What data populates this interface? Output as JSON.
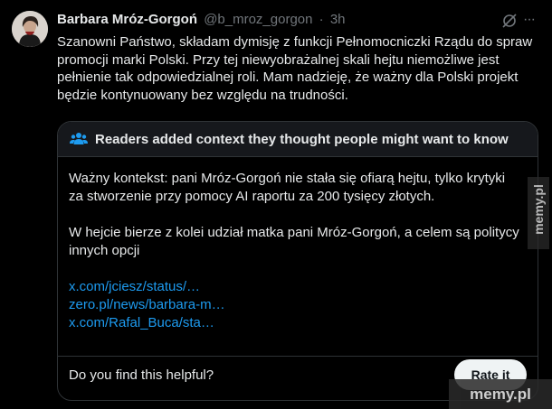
{
  "post": {
    "author_name": "Barbara Mróz-Gorgoń",
    "handle": "@b_mroz_gorgon",
    "separator": "·",
    "time": "3h",
    "more_glyph": "···",
    "text": "Szanowni Państwo, składam dymisję z funkcji Pełnomocniczki Rządu do spraw promocji marki Polski. Przy tej niewyobrażalnej skali hejtu niemożliwe jest pełnienie tak odpowiedzialnej roli. Mam nadzieję, że ważny dla Polski projekt będzie kontynuowany bez względu na trudności."
  },
  "community_note": {
    "title": "Readers added context they thought people might want to know",
    "paragraphs": [
      "Ważny kontekst: pani Mróz-Gorgoń nie stała się ofiarą hejtu, tylko krytyki za stworzenie przy pomocy AI raportu za 200 tysięcy złotych.",
      "W hejcie bierze z kolei udział matka pani Mróz-Gorgoń, a celem są politycy innych opcji"
    ],
    "links": [
      "x.com/jciesz/status/…",
      "zero.pl/news/barbara-m…",
      "x.com/Rafal_Buca/sta…"
    ],
    "helpful_question": "Do you find this helpful?",
    "rate_button": "Rate it"
  },
  "watermarks": {
    "side": "memy.pl",
    "bottom": "memy.pl"
  },
  "icons": [
    "grok-icon",
    "more-icon",
    "people-icon"
  ],
  "colors": {
    "background": "#000000",
    "text": "#e7e9ea",
    "secondary": "#71767b",
    "link": "#1d9bf0",
    "border": "#2f3336"
  }
}
